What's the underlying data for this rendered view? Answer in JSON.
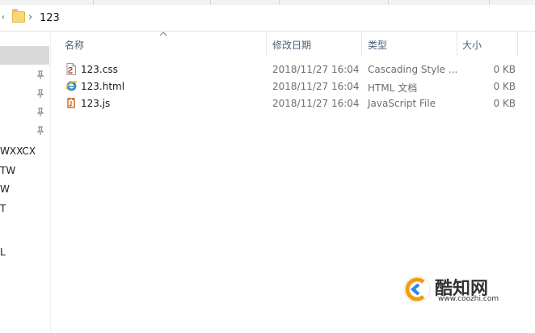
{
  "address": {
    "back_glyph": "‹",
    "separator": "›",
    "current_folder": "123"
  },
  "nav": {
    "labels": [
      "WXXCX",
      "TW",
      "W",
      "T",
      "L"
    ]
  },
  "columns": {
    "name": "名称",
    "date": "修改日期",
    "type": "类型",
    "size": "大小"
  },
  "files": [
    {
      "name": "123.css",
      "date": "2018/11/27 16:04",
      "type": "Cascading Style ...",
      "size": "0 KB",
      "icon": "css-file-icon"
    },
    {
      "name": "123.html",
      "date": "2018/11/27 16:04",
      "type": "HTML 文档",
      "size": "0 KB",
      "icon": "ie-html-file-icon"
    },
    {
      "name": "123.js",
      "date": "2018/11/27 16:04",
      "type": "JavaScript File",
      "size": "0 KB",
      "icon": "js-file-icon"
    }
  ],
  "watermark": {
    "brand": "酷知网",
    "url": "www.coozhi.com"
  },
  "colors": {
    "header_text": "#4c607a",
    "muted_text": "#6d6d6d",
    "folder_yellow": "#f8d775",
    "selection_gray": "#d9d9d9"
  }
}
